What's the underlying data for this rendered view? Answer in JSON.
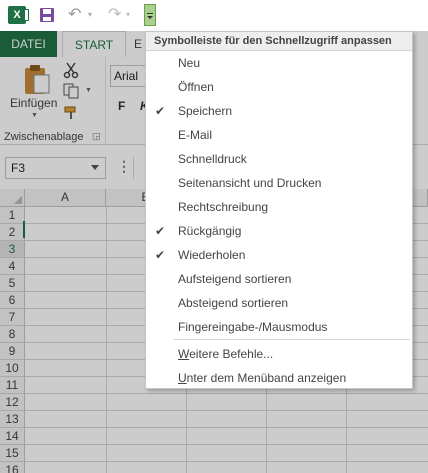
{
  "quick_access": {
    "excel_icon_text": "X",
    "icons": [
      "excel-icon",
      "save-icon",
      "undo-icon",
      "redo-icon",
      "customize-toolbar-icon"
    ]
  },
  "ribbon": {
    "tabs": {
      "file": "DATEI",
      "home": "START",
      "insert_partial": "E"
    },
    "clipboard": {
      "paste_label": "Einfügen",
      "group_label": "Zwischenablage"
    },
    "font": {
      "name": "Arial",
      "bold": "F",
      "italic": "K"
    }
  },
  "formula_bar": {
    "name_box_value": "F3",
    "dots": "⋮"
  },
  "sheet": {
    "columns": [
      "A",
      "B"
    ],
    "rows": [
      "1",
      "2",
      "3",
      "4",
      "5",
      "6",
      "7",
      "8",
      "9",
      "10",
      "11",
      "12",
      "13",
      "14",
      "15",
      "16"
    ],
    "selected_row": "3"
  },
  "menu": {
    "title": "Symbolleiste für den Schnellzugriff anpassen",
    "items": [
      {
        "label": "Neu",
        "checked": false
      },
      {
        "label": "Öffnen",
        "checked": false
      },
      {
        "label": "Speichern",
        "checked": true
      },
      {
        "label": "E-Mail",
        "checked": false
      },
      {
        "label": "Schnelldruck",
        "checked": false
      },
      {
        "label": "Seitenansicht und Drucken",
        "checked": false
      },
      {
        "label": "Rechtschreibung",
        "checked": false
      },
      {
        "label": "Rückgängig",
        "checked": true
      },
      {
        "label": "Wiederholen",
        "checked": true
      },
      {
        "label": "Aufsteigend sortieren",
        "checked": false
      },
      {
        "label": "Absteigend sortieren",
        "checked": false
      },
      {
        "label": "Fingereingabe-/Mausmodus",
        "checked": false
      }
    ],
    "more_commands": "Weitere Befehle...",
    "show_below": "Unter dem Menüband anzeigen",
    "check_glyph": "✔"
  },
  "colors": {
    "excel_green": "#217346",
    "highlight_green": "#a9d08e"
  }
}
